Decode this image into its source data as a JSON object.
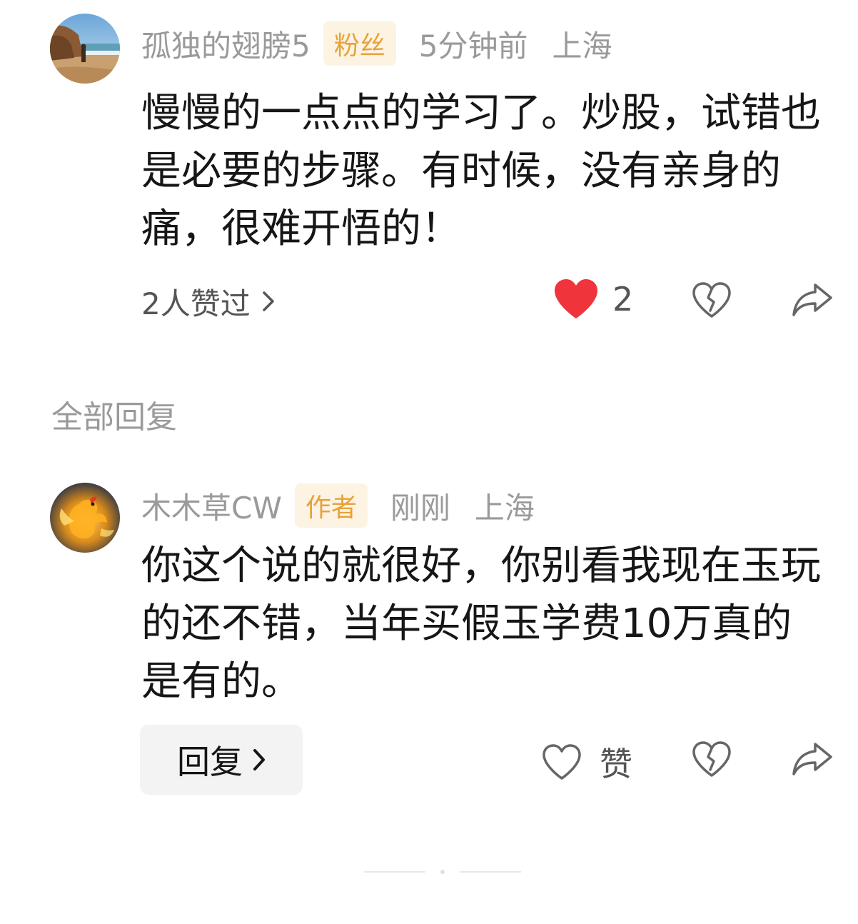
{
  "comment": {
    "username": "孤独的翅膀5",
    "badge": "粉丝",
    "time": "5分钟前",
    "location": "上海",
    "text": "慢慢的一点点的学习了。炒股，试错也是必要的步骤。有时候，没有亲身的痛，很难开悟的！",
    "likes_summary": "2人赞过",
    "like_count": "2",
    "liked": true,
    "colors": {
      "like_red": "#f0343c"
    }
  },
  "replies_header": "全部回复",
  "reply": {
    "username": "木木草CW",
    "badge": "作者",
    "time": "刚刚",
    "location": "上海",
    "text": "你这个说的就很好，你别看我现在玉玩的还不错，当年买假玉学费10万真的是有的。",
    "reply_button": "回复",
    "like_label": "赞"
  },
  "colors": {
    "badge_bg": "#fdf3e3",
    "badge_text": "#e6a23c",
    "meta_gray": "#9a9a9a"
  },
  "icons": [
    "beach-avatar",
    "phoenix-avatar",
    "chevron-right-icon",
    "heart-filled-icon",
    "broken-heart-icon",
    "share-icon",
    "heart-outline-icon"
  ]
}
